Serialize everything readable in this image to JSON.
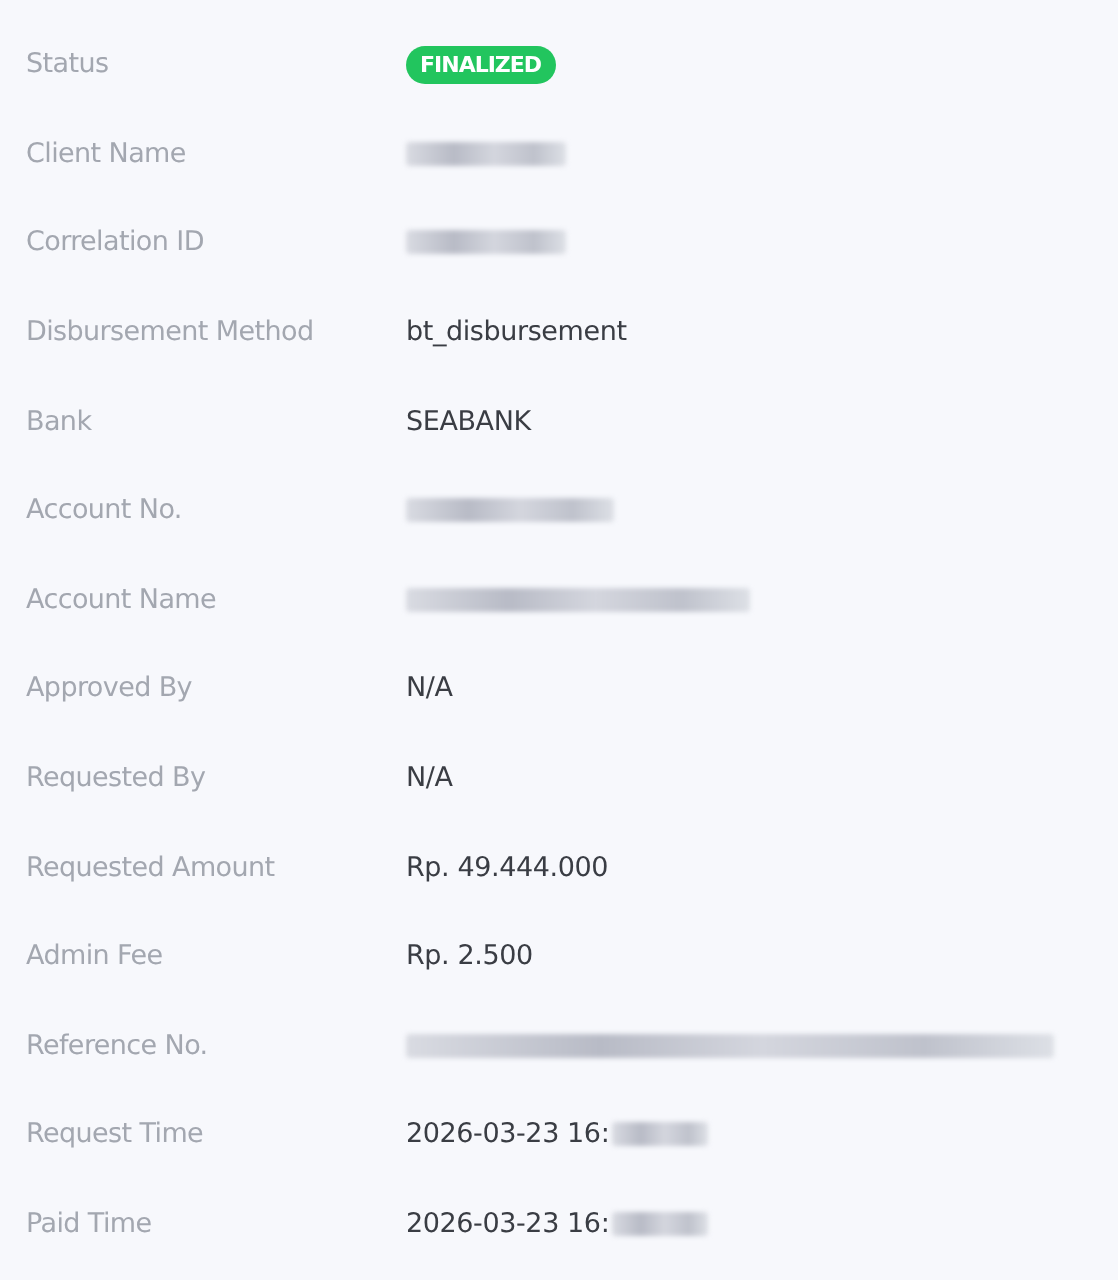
{
  "fields": [
    {
      "label": "Status",
      "kind": "badge",
      "value": "FINALIZED"
    },
    {
      "label": "Client Name",
      "kind": "redacted"
    },
    {
      "label": "Correlation ID",
      "kind": "redacted"
    },
    {
      "label": "Disbursement Method",
      "kind": "text",
      "value": "bt_disbursement"
    },
    {
      "label": "Bank",
      "kind": "text",
      "value": "SEABANK"
    },
    {
      "label": "Account No.",
      "kind": "redacted"
    },
    {
      "label": "Account Name",
      "kind": "redacted"
    },
    {
      "label": "Approved By",
      "kind": "text",
      "value": "N/A"
    },
    {
      "label": "Requested By",
      "kind": "text",
      "value": "N/A"
    },
    {
      "label": "Requested Amount",
      "kind": "text",
      "value": "Rp. 49.444.000"
    },
    {
      "label": "Admin Fee",
      "kind": "text",
      "value": "Rp. 2.500"
    },
    {
      "label": "Reference No.",
      "kind": "redacted"
    },
    {
      "label": "Request Time",
      "kind": "partial",
      "value": "2026-03-23 16:"
    },
    {
      "label": "Paid Time",
      "kind": "partial",
      "value": "2026-03-23 16:"
    }
  ]
}
